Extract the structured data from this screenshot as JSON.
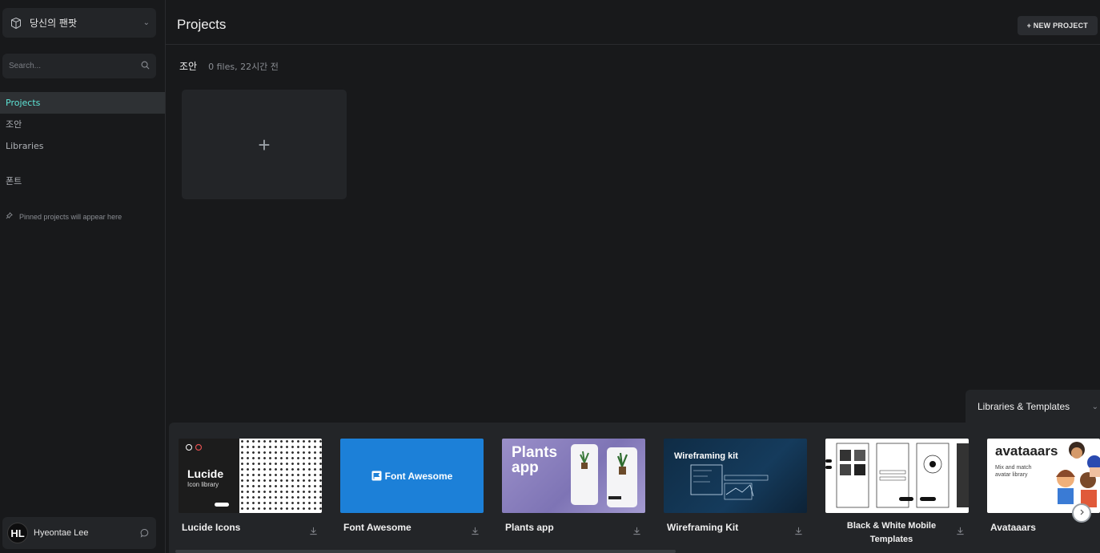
{
  "sidebar": {
    "team_name": "당신의 팬팟",
    "search_placeholder": "Search...",
    "nav": [
      {
        "label": "Projects",
        "active": true
      },
      {
        "label": "조안"
      },
      {
        "label": "Libraries"
      },
      {
        "label": "폰트"
      }
    ],
    "pinned_hint": "Pinned projects will appear here",
    "user": {
      "initials": "HL",
      "name": "Hyeontae Lee"
    }
  },
  "header": {
    "title": "Projects",
    "new_project_label": "+ NEW PROJECT"
  },
  "project": {
    "name": "조안",
    "meta": "0 files, 22시간 전",
    "add_symbol": "+"
  },
  "libraries": {
    "tab_label": "Libraries & Templates",
    "items": [
      {
        "name": "Lucide Icons",
        "thumb_title": "Lucide",
        "thumb_sub": "Icon library"
      },
      {
        "name": "Font Awesome",
        "thumb_title": "Font Awesome"
      },
      {
        "name": "Plants app",
        "thumb_title": "Plants app"
      },
      {
        "name": "Wireframing Kit",
        "thumb_title": "Wireframing kit"
      },
      {
        "name": "Black & White Mobile Templates"
      },
      {
        "name": "Avataaars",
        "thumb_title": "avataaars",
        "thumb_sub": "Mix and match avatar library"
      }
    ]
  },
  "colors": {
    "background": "#18191b",
    "panel": "#232528",
    "accent": "#5ee4d6"
  }
}
